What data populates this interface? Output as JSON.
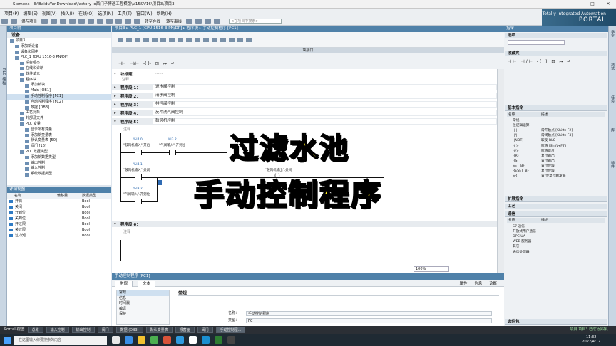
{
  "window": {
    "title": "Siemens  -  E:\\BaiduYunDownload\\factory io西门子博途工程模版\\V15&V16\\项目3\\项目3",
    "brand_line1": "Totally Integrated Automation",
    "brand_line2": "PORTAL"
  },
  "menu": [
    "项目(P)",
    "编辑(E)",
    "视图(V)",
    "插入(I)",
    "在线(O)",
    "选项(N)",
    "工具(T)",
    "窗口(W)",
    "帮助(H)"
  ],
  "toolbar": {
    "save_label": "保存项目",
    "online_label": "转至在线",
    "offline_label": "转至离线",
    "search_placeholder": "<在项目中搜索>"
  },
  "project_tree": {
    "header": "项目树",
    "sidebar_label": "PLC 编程",
    "devices_tab": "设备",
    "items": [
      {
        "label": "项目3",
        "indent": 0
      },
      {
        "label": "添加新设备",
        "indent": 1
      },
      {
        "label": "设备和网络",
        "indent": 1
      },
      {
        "label": "PLC_1 [CPU 1516-3 PN/DP]",
        "indent": 1
      },
      {
        "label": "设备组态",
        "indent": 2
      },
      {
        "label": "在线和诊断",
        "indent": 2
      },
      {
        "label": "软件单元",
        "indent": 2
      },
      {
        "label": "程序块",
        "indent": 2
      },
      {
        "label": "添加新块",
        "indent": 3
      },
      {
        "label": "Main [OB1]",
        "indent": 3
      },
      {
        "label": "手动控制程序 [FC1]",
        "indent": 3
      },
      {
        "label": "自动控制程序 [FC2]",
        "indent": 3
      },
      {
        "label": "数据 [DB3]",
        "indent": 3
      },
      {
        "label": "工艺对象",
        "indent": 2
      },
      {
        "label": "外部源文件",
        "indent": 2
      },
      {
        "label": "PLC 变量",
        "indent": 2
      },
      {
        "label": "显示所有变量",
        "indent": 3
      },
      {
        "label": "添加新变量表",
        "indent": 3
      },
      {
        "label": "默认变量表 [50]",
        "indent": 3
      },
      {
        "label": "阀门 [16]",
        "indent": 3
      },
      {
        "label": "PLC 数据类型",
        "indent": 2
      },
      {
        "label": "添加新数据类型",
        "indent": 3
      },
      {
        "label": "输出控制",
        "indent": 3
      },
      {
        "label": "输入控制",
        "indent": 3
      },
      {
        "label": "系统数据类型",
        "indent": 3
      }
    ]
  },
  "detail_view": {
    "header": "详细视图",
    "cols": [
      "名称",
      "地址",
      ""
    ],
    "col_name": "名称",
    "col_addr": "偏移量",
    "col_type": "数据类型",
    "rows": [
      {
        "name": "开启",
        "type": "Bool"
      },
      {
        "name": "关闭",
        "type": "Bool"
      },
      {
        "name": "开到位",
        "type": "Bool"
      },
      {
        "name": "关到位",
        "type": "Bool"
      },
      {
        "name": "开过限",
        "type": "Bool"
      },
      {
        "name": "关过限",
        "type": "Bool"
      },
      {
        "name": "过力矩",
        "type": "Bool"
      }
    ]
  },
  "editor": {
    "path": "项目3 ▸ PLC_1 [CPU 1516-3 PN/DP] ▸ 程序块 ▸ 手动控制程序 [FC1]",
    "block_interface": "块接口",
    "block_title": "块标题：",
    "block_title_hint": "......",
    "comment": "注释",
    "segments": [
      {
        "num": "程序段 1：",
        "name": "进水阀控制"
      },
      {
        "num": "程序段 2：",
        "name": "清水阀控制"
      },
      {
        "num": "程序段 3：",
        "name": "排污阀控制"
      },
      {
        "num": "程序段 4：",
        "name": "反冲洗气阀控制"
      },
      {
        "num": "程序段 5：",
        "name": "鼓风机控制"
      },
      {
        "num": "程序段 6：",
        "name": "......"
      }
    ],
    "net5": {
      "c1_addr": "%I4.0",
      "c1_name": "\"鼓风机输入\".开启",
      "c2_addr": "%I3.2",
      "c2_name": "\"气阀输入\".开到位",
      "c3_addr": "%I4.1",
      "c3_name": "\"鼓风机输入\".关闭",
      "c4_addr": "%I3.2",
      "c4_name": "\"气阀输入\".开到位",
      "coil_name": "\"鼓风机输出\".关闭"
    },
    "zoom": "100%"
  },
  "properties": {
    "header": "手动控制程序 [FC1]",
    "tab_general": "常规",
    "tab_text": "文本",
    "right_tabs": [
      "属性",
      "信息",
      "诊断"
    ],
    "nav": [
      "常规",
      "信息",
      "时间戳",
      "编译",
      "保护"
    ],
    "section": "常规",
    "name_label": "名称：",
    "name_value": "手动控制程序",
    "type_label": "类型：",
    "type_value": "FC"
  },
  "task": {
    "header": "指令",
    "options": "选项",
    "favorites": "收藏夹",
    "basic": "基本指令",
    "col_name": "名称",
    "col_desc": "描述",
    "basic_items": [
      {
        "name": "常规",
        "desc": ""
      },
      {
        "name": "位逻辑运算",
        "desc": ""
      },
      {
        "name": "-| |-",
        "desc": "常开触点 [Shift+F2]"
      },
      {
        "name": "-|/|-",
        "desc": "常闭触点 [Shift+F3]"
      },
      {
        "name": "-|NOT|-",
        "desc": "取反 RLO"
      },
      {
        "name": "-( )-",
        "desc": "赋值 [Shift+F7]"
      },
      {
        "name": "-(/)-",
        "desc": "赋值取反"
      },
      {
        "name": "-(R)",
        "desc": "复位输出"
      },
      {
        "name": "-(S)",
        "desc": "置位输出"
      },
      {
        "name": "SET_BF",
        "desc": "置位位域"
      },
      {
        "name": "RESET_BF",
        "desc": "复位位域"
      },
      {
        "name": "SR",
        "desc": "置位/复位触发器"
      }
    ],
    "extended": "扩展指令",
    "tech": "工艺",
    "comm": "通信",
    "comm_items": [
      {
        "name": "S7 通信",
        "desc": ""
      },
      {
        "name": "开放式用户通信",
        "desc": ""
      },
      {
        "name": "OPC UA",
        "desc": ""
      },
      {
        "name": "WEB 服务器",
        "desc": ""
      },
      {
        "name": "其它",
        "desc": ""
      },
      {
        "name": "通信处理器",
        "desc": ""
      }
    ],
    "optional": "选件包",
    "sidebar": [
      "指令",
      "测试",
      "任务",
      "库",
      "插件"
    ]
  },
  "portal": {
    "label": "Portal 视图",
    "tabs": [
      "总览",
      "输入控制",
      "输出控制",
      "阀门",
      "数据 (DB3)",
      "默认变量表",
      "根菌面",
      "阀门",
      "手动控制程..."
    ],
    "status": "项目 项目3 已成功保存。"
  },
  "taskbar": {
    "search_placeholder": "在这里输入你要搜索的内容",
    "time": "11:32",
    "date": "2022/4/12"
  },
  "overlay": {
    "line1": "过滤水池",
    "line2": "手动控制程序"
  }
}
